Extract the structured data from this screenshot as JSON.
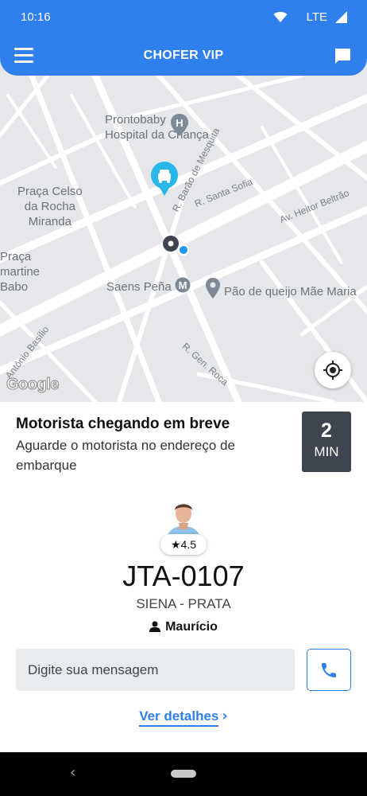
{
  "status_bar": {
    "time": "10:16",
    "network": "LTE"
  },
  "app_bar": {
    "title": "CHOFER VIP",
    "menu_icon": "menu-icon",
    "chat_icon": "chat-icon"
  },
  "map": {
    "places": {
      "prontobaby": "Prontobaby\nHospital da Criança",
      "praca_celso": "Praça Celso\nda Rocha\nMiranda",
      "praca_martine": "Praça\nmartine\nBabo",
      "saens_pena": "Saens Peña",
      "pao_de_queijo": "Pão de queijo Mãe Maria"
    },
    "streets": {
      "barao_mesquita": "R. Barão de Mesquita",
      "santa_sofia": "R. Santa Sofia",
      "heitor_beltrao": "Av. Heitor Beltrão",
      "antonio_basilio": "Antônio Basílio",
      "gen_roca": "R. Gen. Roca"
    },
    "attribution": "Google",
    "colors": {
      "car_marker": "#29b6e8",
      "user_dot": "#2196f3",
      "hospital": "#7d8a96"
    }
  },
  "arrival": {
    "title": "Motorista chegando em breve",
    "subtitle": "Aguarde o motorista no endereço de embarque",
    "eta_value": "2",
    "eta_unit": "MIN"
  },
  "driver": {
    "rating": "★4.5",
    "plate": "JTA-0107",
    "car": "SIENA - PRATA",
    "name": "Maurício"
  },
  "message": {
    "placeholder": "Digite sua mensagem"
  },
  "details_link": "Ver detalhes",
  "accent_color": "#2f80ed"
}
